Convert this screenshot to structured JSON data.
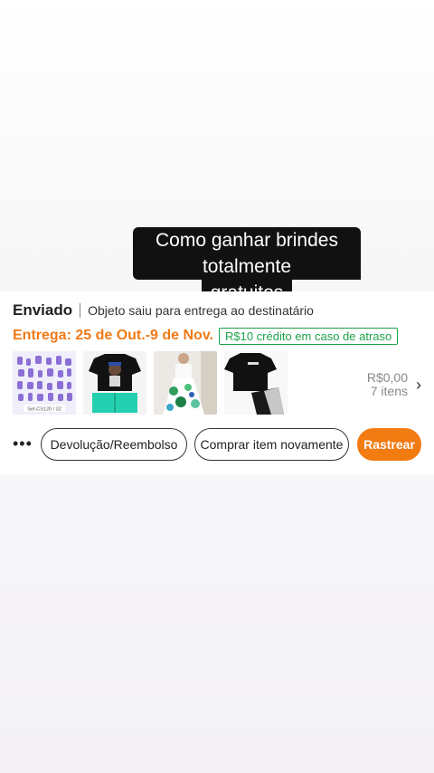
{
  "caption": {
    "line1": "Como ganhar brindes totalmente",
    "line2": "gratuitos"
  },
  "order": {
    "status": "Enviado",
    "status_detail": "Objeto saiu para entrega ao destinatário",
    "delivery": "Entrega: 25 de Out.-9 de Nov.",
    "credit_badge": "R$10 crédito em caso de atraso",
    "product_images": [
      "nail-stickers-sheet",
      "black-tshirt-bear-outfit",
      "floral-skirt-outfit",
      "black-tshirt-shorts-set"
    ],
    "sticker_caption": "Set-CS120 / 32",
    "total": "R$0,00",
    "item_count": "7 itens",
    "colors": {
      "accent": "#f27b12",
      "credit_green": "#1fa24a"
    }
  },
  "actions": {
    "more": "•••",
    "return_label": "Devolução/Reembolso",
    "buy_again_label": "Comprar item novamente",
    "track_label": "Rastrear"
  }
}
